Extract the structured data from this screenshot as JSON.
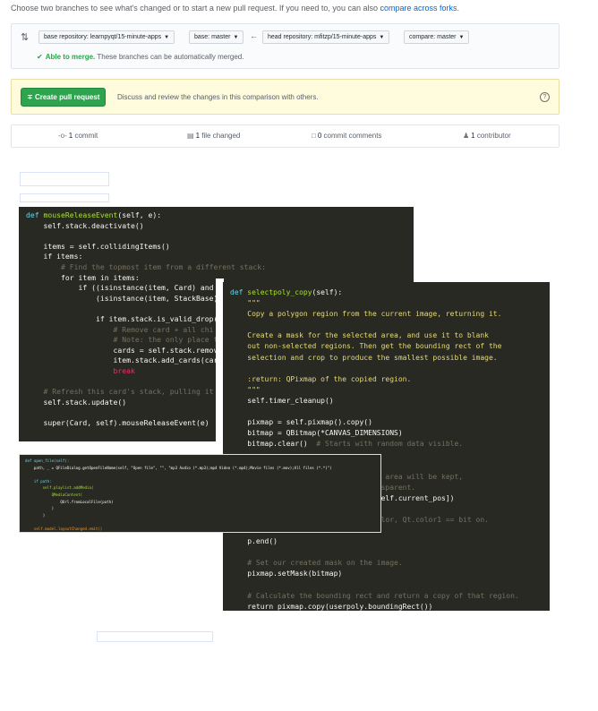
{
  "intro": {
    "text": "Choose two branches to see what's changed or to start a new pull request. If you need to, you can also ",
    "link": "compare across forks",
    "end": "."
  },
  "range": {
    "base_repository": "base repository: learnpyqt/15-minute-apps",
    "base": "base: master",
    "head_repository": "head repository: mfitzp/15-minute-apps",
    "compare": "compare: master",
    "merge_ok": "Able to merge.",
    "merge_text": " These branches can be automatically merged."
  },
  "pull_request": {
    "button": "Create pull request",
    "description": "Discuss and review the changes in this comparison with others."
  },
  "stats": {
    "commits_num": "1",
    "commits_label": " commit",
    "files_num": "1",
    "files_label": " file changed",
    "comments_num": "0",
    "comments_label": " commit comments",
    "contributors_num": "1",
    "contributors_label": " contributor"
  },
  "code1": {
    "l1_def": "def ",
    "l1_fn": "mouseReleaseEvent",
    "l1_rest": "(self, e):",
    "l2": "    self.stack.deactivate()",
    "l3": "",
    "l4": "    items = self.collidingItems()",
    "l5": "    if items:",
    "l6": "        # Find the topmost item from a different stack:",
    "l7": "        for item in items:",
    "l8": "            if ((isinstance(item, Card) and",
    "l9": "                (isinstance(item, StackBase)",
    "l10": "",
    "l11": "                if item.stack.is_valid_drop(",
    "l12": "                    # Remove card + all chi",
    "l13": "                    # Note: the only place t",
    "l14": "                    cards = self.stack.remov",
    "l15": "                    item.stack.add_cards(car",
    "l16": "                    break",
    "l17": "",
    "l18": "    # Refresh this card's stack, pulling it",
    "l19": "    self.stack.update()",
    "l20": "",
    "l21": "    super(Card, self).mouseReleaseEvent(e)"
  },
  "code2": {
    "l1_def": "def ",
    "l1_fn": "selectpoly_copy",
    "l1_rest": "(self):",
    "l2": "    \"\"\"",
    "l3": "    Copy a polygon region from the current image, returning it.",
    "l4": "",
    "l5": "    Create a mask for the selected area, and use it to blank",
    "l6": "    out non-selected regions. Then get the bounding rect of the",
    "l7": "    selection and crop to produce the smallest possible image.",
    "l8": "",
    "l9": "    :return: QPixmap of the copied region.",
    "l10": "    \"\"\"",
    "l11": "    self.timer_cleanup()",
    "l12": "",
    "l13": "    pixmap = self.pixmap().copy()",
    "l14": "    bitmap = QBitmap(*CANVAS_DIMENSIONS)",
    "l15_code": "    bitmap.clear()  ",
    "l15_cm": "# Starts with random data visible.",
    "l16": "",
    "l17": "",
    "l18": "                         r selected area will be kept,",
    "l19": "                         ge is transparent.",
    "l20": "                         y_pos + [self.current_pos])",
    "l21": "",
    "l22": "                         # Solid color, Qt.color1 == bit on.",
    "l23": "",
    "l24": "    p.end()",
    "l25": "",
    "l26": "    # Set our created mask on the image.",
    "l27": "    pixmap.setMask(bitmap)",
    "l28": "",
    "l29": "    # Calculate the bounding rect and return a copy of that region.",
    "l30": "    return pixmap.copy(userpoly.boundingRect())"
  },
  "code3": {
    "l1": "def open_file(self):",
    "l2": "    path, _ = QFileDialog.getOpenFileName(self, \"Open file\", \"\", \"mp3 Audio (*.mp3);mp4 Video (*.mp4);Movie files (*.mov);All files (*.*)\")",
    "l3": "",
    "l4": "    if path:",
    "l5": "        self.playlist.addMedia(",
    "l6": "            QMediaContent(",
    "l7": "                QUrl.fromLocalFile(path)",
    "l8": "            )",
    "l9": "        )",
    "l10": "",
    "l11": "    self.model.layoutChanged.emit()"
  }
}
